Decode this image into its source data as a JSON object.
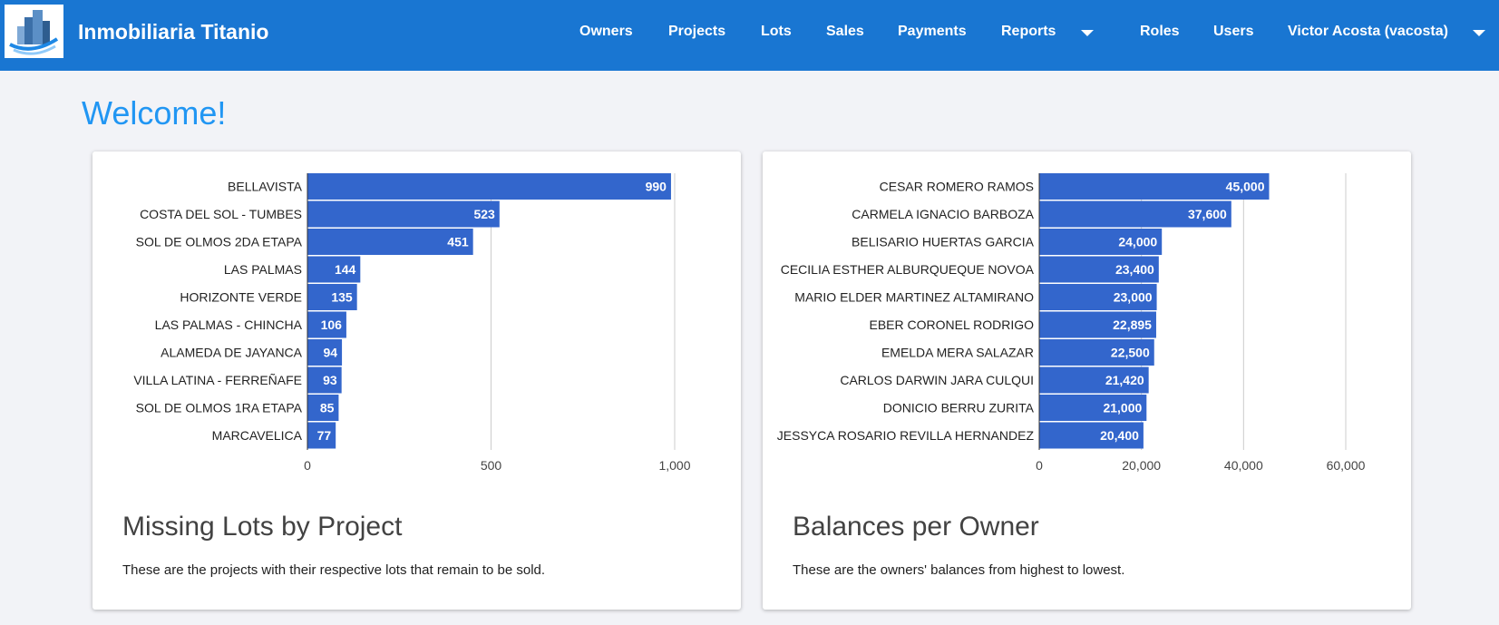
{
  "app": {
    "brand": "Inmobiliaria Titanio"
  },
  "nav": {
    "owners": "Owners",
    "projects": "Projects",
    "lots": "Lots",
    "sales": "Sales",
    "payments": "Payments",
    "reports": "Reports",
    "roles": "Roles",
    "users": "Users",
    "user": "Victor Acosta (vacosta)"
  },
  "page": {
    "welcome": "Welcome!"
  },
  "colors": {
    "navbar": "#1976d2",
    "bar": "#3366cc",
    "welcome": "#2196f3",
    "background": "#f2f3f7"
  },
  "cards": [
    {
      "title": "Missing Lots by Project",
      "text": "These are the projects with their respective lots that remain to be sold."
    },
    {
      "title": "Balances per Owner",
      "text": "These are the owners' balances from highest to lowest."
    }
  ],
  "chart_data": [
    {
      "type": "bar",
      "orientation": "horizontal",
      "categories": [
        "BELLAVISTA",
        "COSTA DEL SOL - TUMBES",
        "SOL DE OLMOS 2DA ETAPA",
        "LAS PALMAS",
        "HORIZONTE VERDE",
        "LAS PALMAS - CHINCHA",
        "ALAMEDA DE JAYANCA",
        "VILLA LATINA - FERREÑAFE",
        "SOL DE OLMOS 1RA ETAPA",
        "MARCAVELICA"
      ],
      "values": [
        990,
        523,
        451,
        144,
        135,
        106,
        94,
        93,
        85,
        77
      ],
      "value_labels": [
        "990",
        "523",
        "451",
        "144",
        "135",
        "106",
        "94",
        "93",
        "85",
        "77"
      ],
      "xticks": [
        0,
        500,
        1000
      ],
      "xtick_labels": [
        "0",
        "500",
        "1,000"
      ],
      "xlim": [
        0,
        1000
      ],
      "grid": true,
      "title": "",
      "xlabel": "",
      "ylabel": ""
    },
    {
      "type": "bar",
      "orientation": "horizontal",
      "categories": [
        "CESAR ROMERO RAMOS",
        "CARMELA IGNACIO BARBOZA",
        "BELISARIO HUERTAS GARCIA",
        "CECILIA ESTHER ALBURQUEQUE NOVOA",
        "MARIO ELDER MARTINEZ ALTAMIRANO",
        "EBER CORONEL RODRIGO",
        "EMELDA MERA SALAZAR",
        "CARLOS DARWIN JARA CULQUI",
        "DONICIO BERRU ZURITA",
        "JESSYCA ROSARIO REVILLA HERNANDEZ"
      ],
      "values": [
        45000,
        37600,
        24000,
        23400,
        23000,
        22895,
        22500,
        21420,
        21000,
        20400
      ],
      "value_labels": [
        "45,000",
        "37,600",
        "24,000",
        "23,400",
        "23,000",
        "22,895",
        "22,500",
        "21,420",
        "21,000",
        "20,400"
      ],
      "xticks": [
        0,
        20000,
        40000,
        60000
      ],
      "xtick_labels": [
        "0",
        "20,000",
        "40,000",
        "60,000"
      ],
      "xlim": [
        0,
        60000
      ],
      "grid": true,
      "title": "",
      "xlabel": "",
      "ylabel": ""
    }
  ]
}
